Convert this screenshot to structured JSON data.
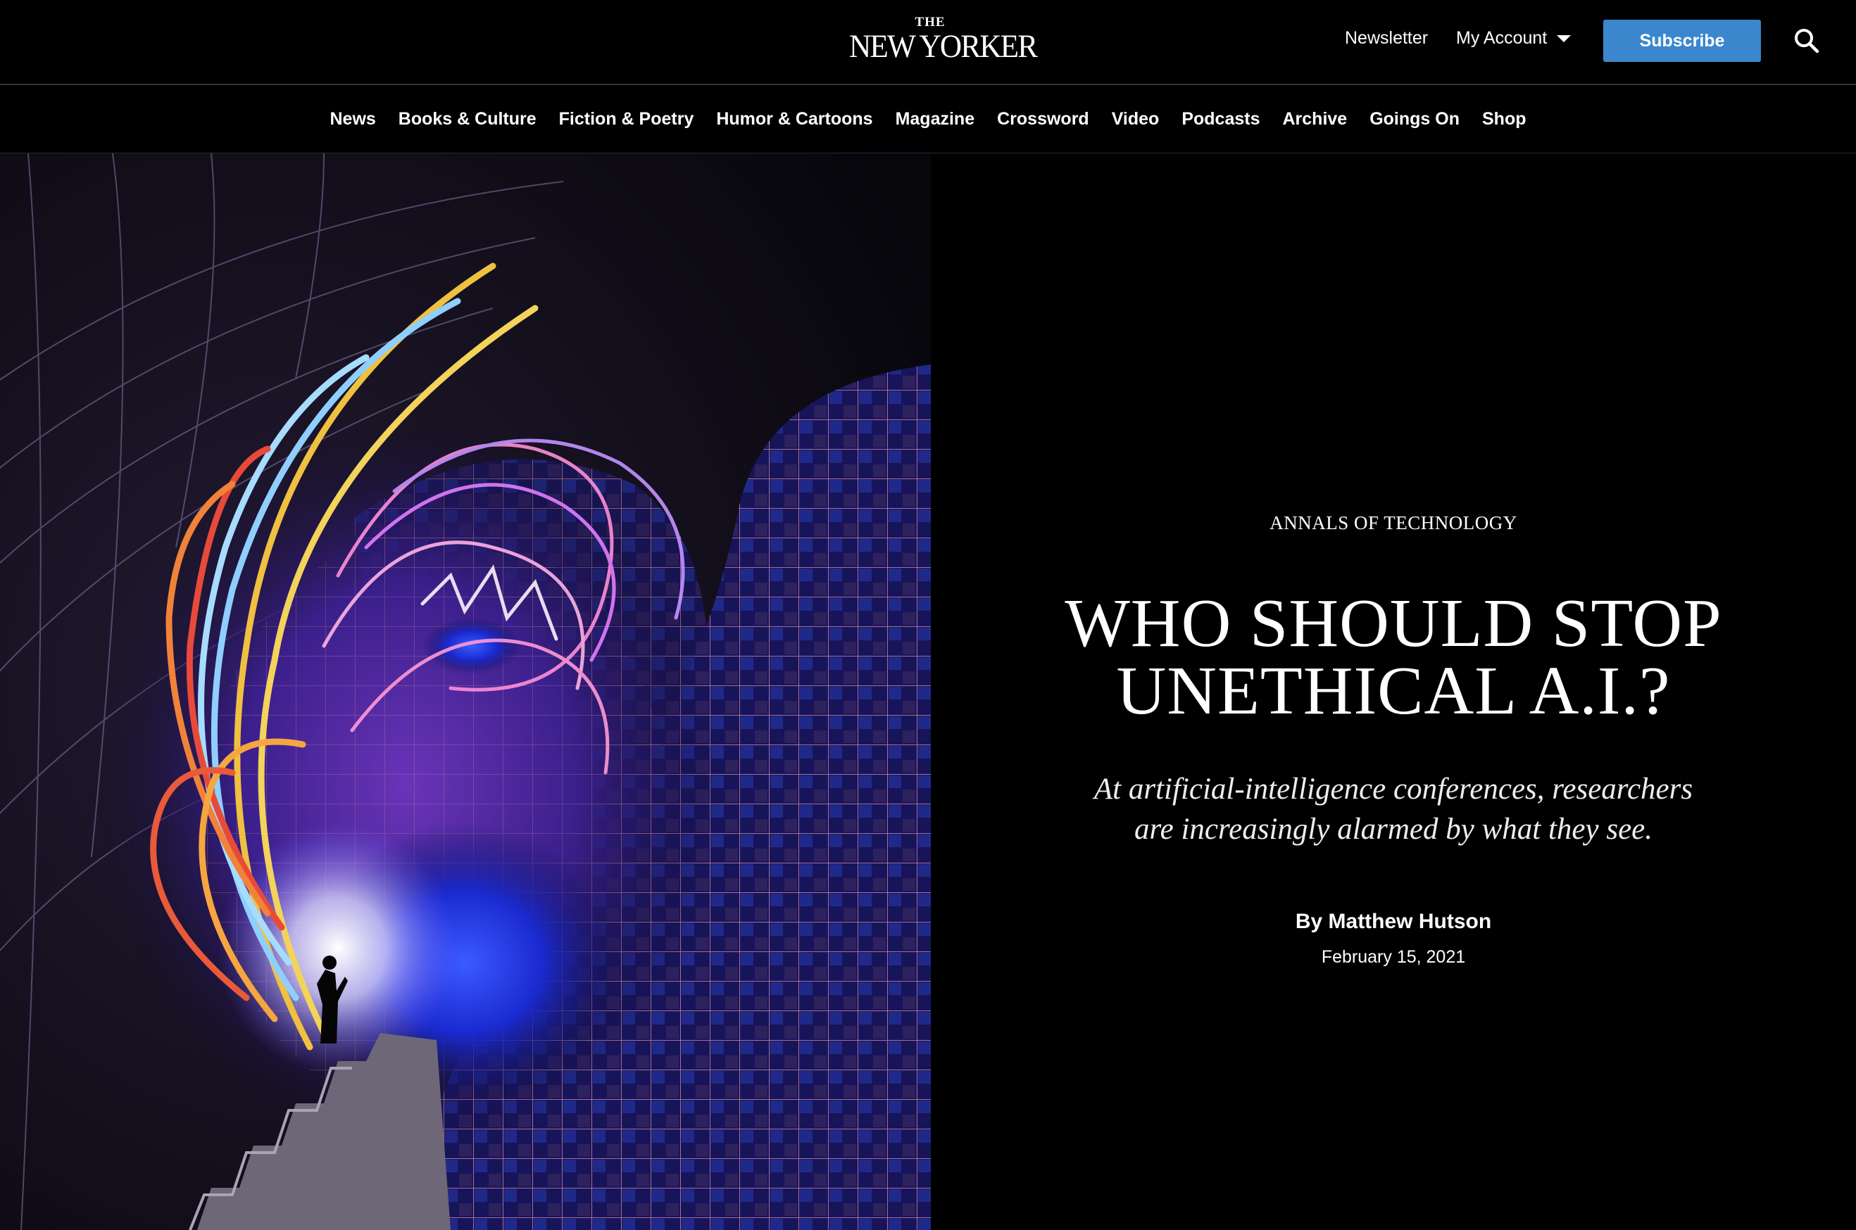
{
  "header": {
    "logo_the": "THE",
    "logo_name": "NEW YORKER",
    "newsletter_label": "Newsletter",
    "account_label": "My Account",
    "subscribe_label": "Subscribe",
    "icons": {
      "search": "search-icon",
      "account_dropdown": "chevron-down-icon"
    },
    "colors": {
      "background": "#000000",
      "subscribe": "#3a87cd"
    }
  },
  "nav": {
    "items": [
      {
        "label": "News"
      },
      {
        "label": "Books & Culture"
      },
      {
        "label": "Fiction & Poetry"
      },
      {
        "label": "Humor & Cartoons"
      },
      {
        "label": "Magazine"
      },
      {
        "label": "Crossword"
      },
      {
        "label": "Video"
      },
      {
        "label": "Podcasts"
      },
      {
        "label": "Archive"
      },
      {
        "label": "Goings On"
      },
      {
        "label": "Shop"
      }
    ]
  },
  "article": {
    "rubric": "ANNALS OF TECHNOLOGY",
    "headline_line1": "WHO SHOULD STOP",
    "headline_line2": "UNETHICAL A.I.?",
    "dek": "At artificial-intelligence conferences, researchers are increasingly alarmed by what they see.",
    "byline": "By Matthew Hutson",
    "date": "February 15, 2021"
  }
}
